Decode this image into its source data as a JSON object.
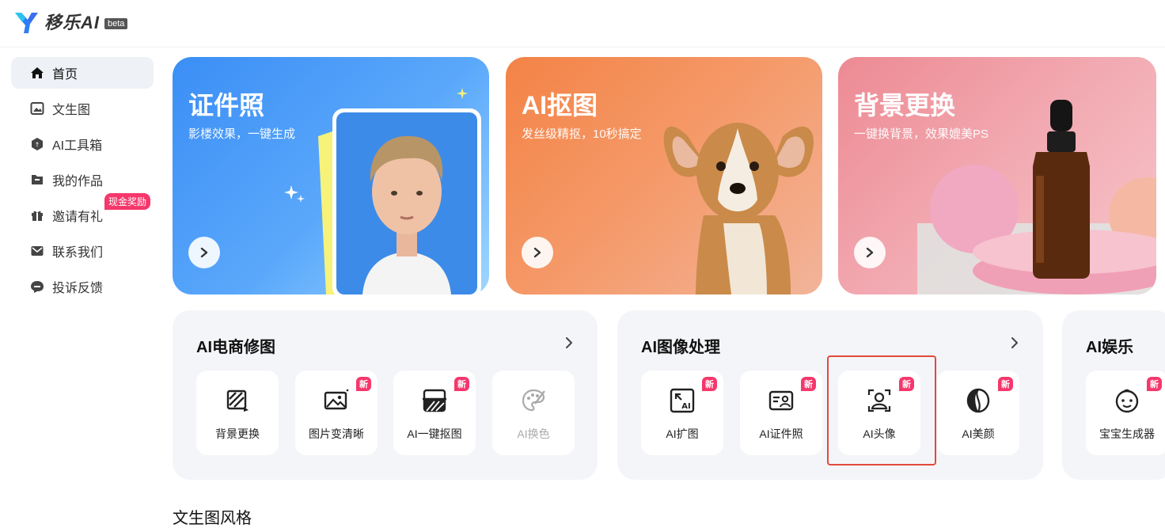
{
  "header": {
    "logo_text": "移乐AI",
    "beta_label": "beta"
  },
  "sidebar": {
    "items": [
      {
        "label": "首页",
        "icon": "home-icon"
      },
      {
        "label": "文生图",
        "icon": "image-icon"
      },
      {
        "label": "AI工具箱",
        "icon": "toolbox-icon"
      },
      {
        "label": "我的作品",
        "icon": "folder-icon"
      },
      {
        "label": "邀请有礼",
        "icon": "gift-icon",
        "badge": "现金奖励"
      },
      {
        "label": "联系我们",
        "icon": "mail-icon"
      },
      {
        "label": "投诉反馈",
        "icon": "feedback-icon"
      }
    ]
  },
  "banners": [
    {
      "title": "证件照",
      "subtitle": "影楼效果，一键生成"
    },
    {
      "title": "AI抠图",
      "subtitle": "发丝级精抠，10秒搞定"
    },
    {
      "title": "背景更换",
      "subtitle": "一键换背景，效果媲美PS"
    }
  ],
  "categories": [
    {
      "title": "AI电商修图",
      "tools": [
        {
          "label": "背景更换",
          "icon": "background-swap-icon",
          "new": ""
        },
        {
          "label": "图片变清晰",
          "icon": "image-enhance-icon",
          "new": "新"
        },
        {
          "label": "AI一键抠图",
          "icon": "cutout-icon",
          "new": "新"
        },
        {
          "label": "AI换色",
          "icon": "palette-icon",
          "new": ""
        }
      ]
    },
    {
      "title": "AI图像处理",
      "tools": [
        {
          "label": "AI扩图",
          "icon": "expand-icon",
          "new": "新"
        },
        {
          "label": "AI证件照",
          "icon": "id-card-icon",
          "new": "新"
        },
        {
          "label": "AI头像",
          "icon": "avatar-icon",
          "new": "新"
        },
        {
          "label": "AI美颜",
          "icon": "beauty-icon",
          "new": "新"
        }
      ]
    },
    {
      "title": "AI娱乐",
      "tools": [
        {
          "label": "宝宝生成器",
          "icon": "baby-icon",
          "new": "新"
        }
      ]
    }
  ],
  "section": {
    "title": "文生图风格"
  },
  "colors": {
    "accent_badge": "#f5376b",
    "highlight_border": "#e24a3b"
  }
}
